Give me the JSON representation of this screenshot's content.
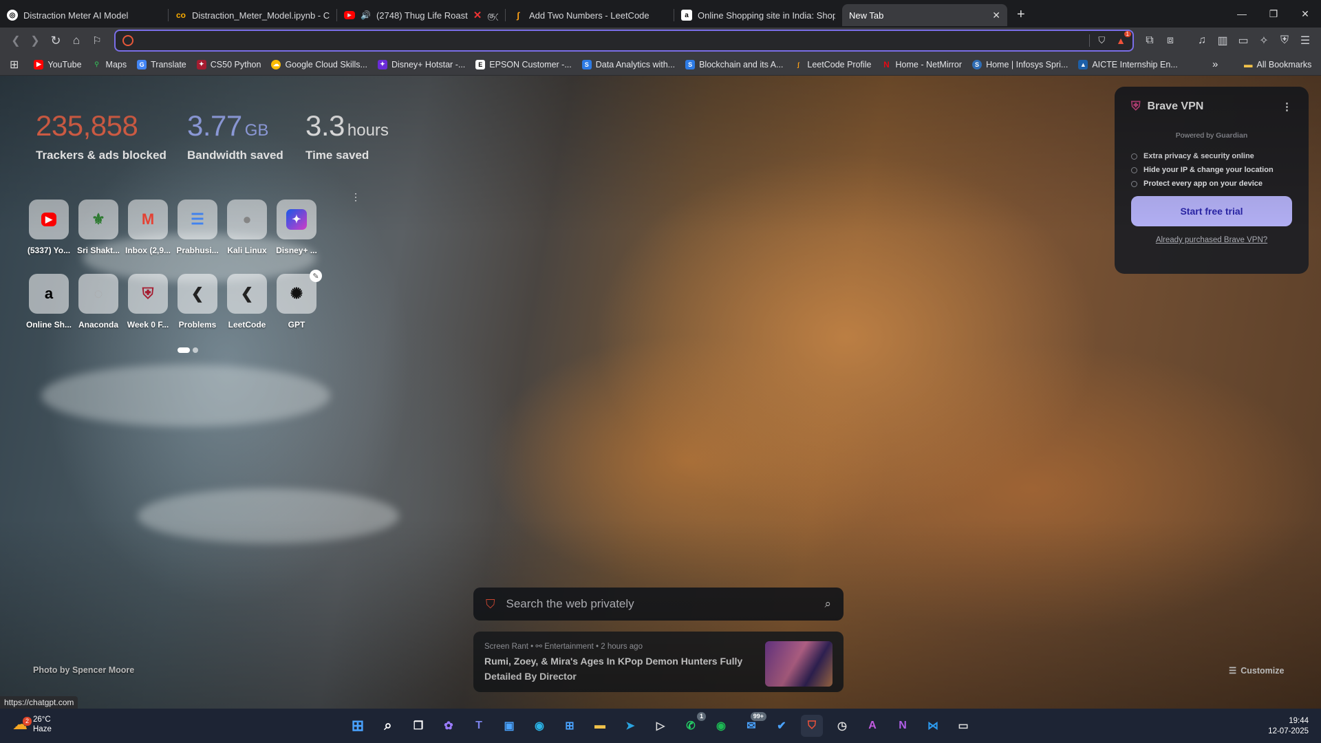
{
  "tabs": [
    {
      "title": "Distraction Meter AI Model",
      "favicon": "chatgpt-icon"
    },
    {
      "title": "Distraction_Meter_Model.ipynb - Col",
      "favicon": "colab-icon"
    },
    {
      "title": "(2748) Thug Life Roast",
      "favicon": "youtube-icon",
      "extra": "குமு"
    },
    {
      "title": "Add Two Numbers - LeetCode",
      "favicon": "leetcode-icon"
    },
    {
      "title": "Online Shopping site in India: Shop C",
      "favicon": "amazon-icon"
    },
    {
      "title": "New Tab",
      "favicon": "none"
    }
  ],
  "address_bar": {
    "value": ""
  },
  "toolbar": {
    "shield_badge": "1"
  },
  "bookmarks": [
    {
      "label": "YouTube",
      "color": "#ff0000"
    },
    {
      "label": "Maps",
      "color": "#34a853"
    },
    {
      "label": "Translate",
      "color": "#4285f4"
    },
    {
      "label": "CS50 Python",
      "color": "#a51c30"
    },
    {
      "label": "Google Cloud Skills...",
      "color": "#fbbc05"
    },
    {
      "label": "Disney+ Hotstar -...",
      "color": "#1f80e0"
    },
    {
      "label": "EPSON Customer -...",
      "color": "#ffffff"
    },
    {
      "label": "Data Analytics with...",
      "color": "#2d7be5"
    },
    {
      "label": "Blockchain and its A...",
      "color": "#2d7be5"
    },
    {
      "label": "LeetCode Profile",
      "color": "#ffa116"
    },
    {
      "label": "Home - NetMirror",
      "color": "#e50914"
    },
    {
      "label": "Home | Infosys Spri...",
      "color": "#2f6db5"
    },
    {
      "label": "AICTE Internship En...",
      "color": "#1d5fa8"
    }
  ],
  "bookmarks_more": "»",
  "all_bookmarks": "All Bookmarks",
  "stats": {
    "trackers": {
      "value": "235,858",
      "label": "Trackers & ads blocked",
      "color": "#f26b4f"
    },
    "bandwidth": {
      "value": "3.77",
      "unit": "GB",
      "label": "Bandwidth saved",
      "color": "#a5b5ff"
    },
    "time": {
      "value": "3.3",
      "unit": "hours",
      "label": "Time saved",
      "color": "#ffffff"
    }
  },
  "top_sites_row1": [
    {
      "label": "(5337) Yo...",
      "icon": "youtube-icon"
    },
    {
      "label": "Sri Shakt...",
      "icon": "college-crest-icon"
    },
    {
      "label": "Inbox (2,9...",
      "icon": "gmail-icon"
    },
    {
      "label": "Prabhusi...",
      "icon": "docs-icon"
    },
    {
      "label": "Kali Linux",
      "icon": "globe-icon"
    },
    {
      "label": "Disney+ ...",
      "icon": "disney-plus-icon"
    }
  ],
  "top_sites_row2": [
    {
      "label": "Online Sh...",
      "icon": "amazon-icon"
    },
    {
      "label": "Anaconda",
      "icon": "anaconda-icon"
    },
    {
      "label": "Week 0 F...",
      "icon": "harvard-icon"
    },
    {
      "label": "Problems",
      "icon": "leetcode-icon"
    },
    {
      "label": "LeetCode",
      "icon": "leetcode-icon"
    },
    {
      "label": "GPT",
      "icon": "chatgpt-icon"
    }
  ],
  "vpn": {
    "title": "Brave VPN",
    "powered_by": "Powered by",
    "powered_brand": "Guardian",
    "features": [
      "Extra privacy & security online",
      "Hide your IP & change your location",
      "Protect every app on your device"
    ],
    "cta": "Start free trial",
    "link": "Already purchased Brave VPN?"
  },
  "search": {
    "placeholder": "Search the web privately"
  },
  "news": {
    "source": "Screen Rant",
    "category": "Entertainment",
    "time": "2 hours ago",
    "headline": "Rumi, Zoey, & Mira's Ages In KPop Demon Hunters Fully Detailed By Director"
  },
  "photo_credit": "Photo by Spencer Moore",
  "customize_label": "Customize",
  "status_url": "https://chatgpt.com",
  "weather": {
    "temp": "26°C",
    "condition": "Haze",
    "badge": "2"
  },
  "clock": {
    "time": "19:44",
    "date": "12-07-2025"
  },
  "taskbar_badges": {
    "whatsapp": "1",
    "mail": "99+"
  }
}
